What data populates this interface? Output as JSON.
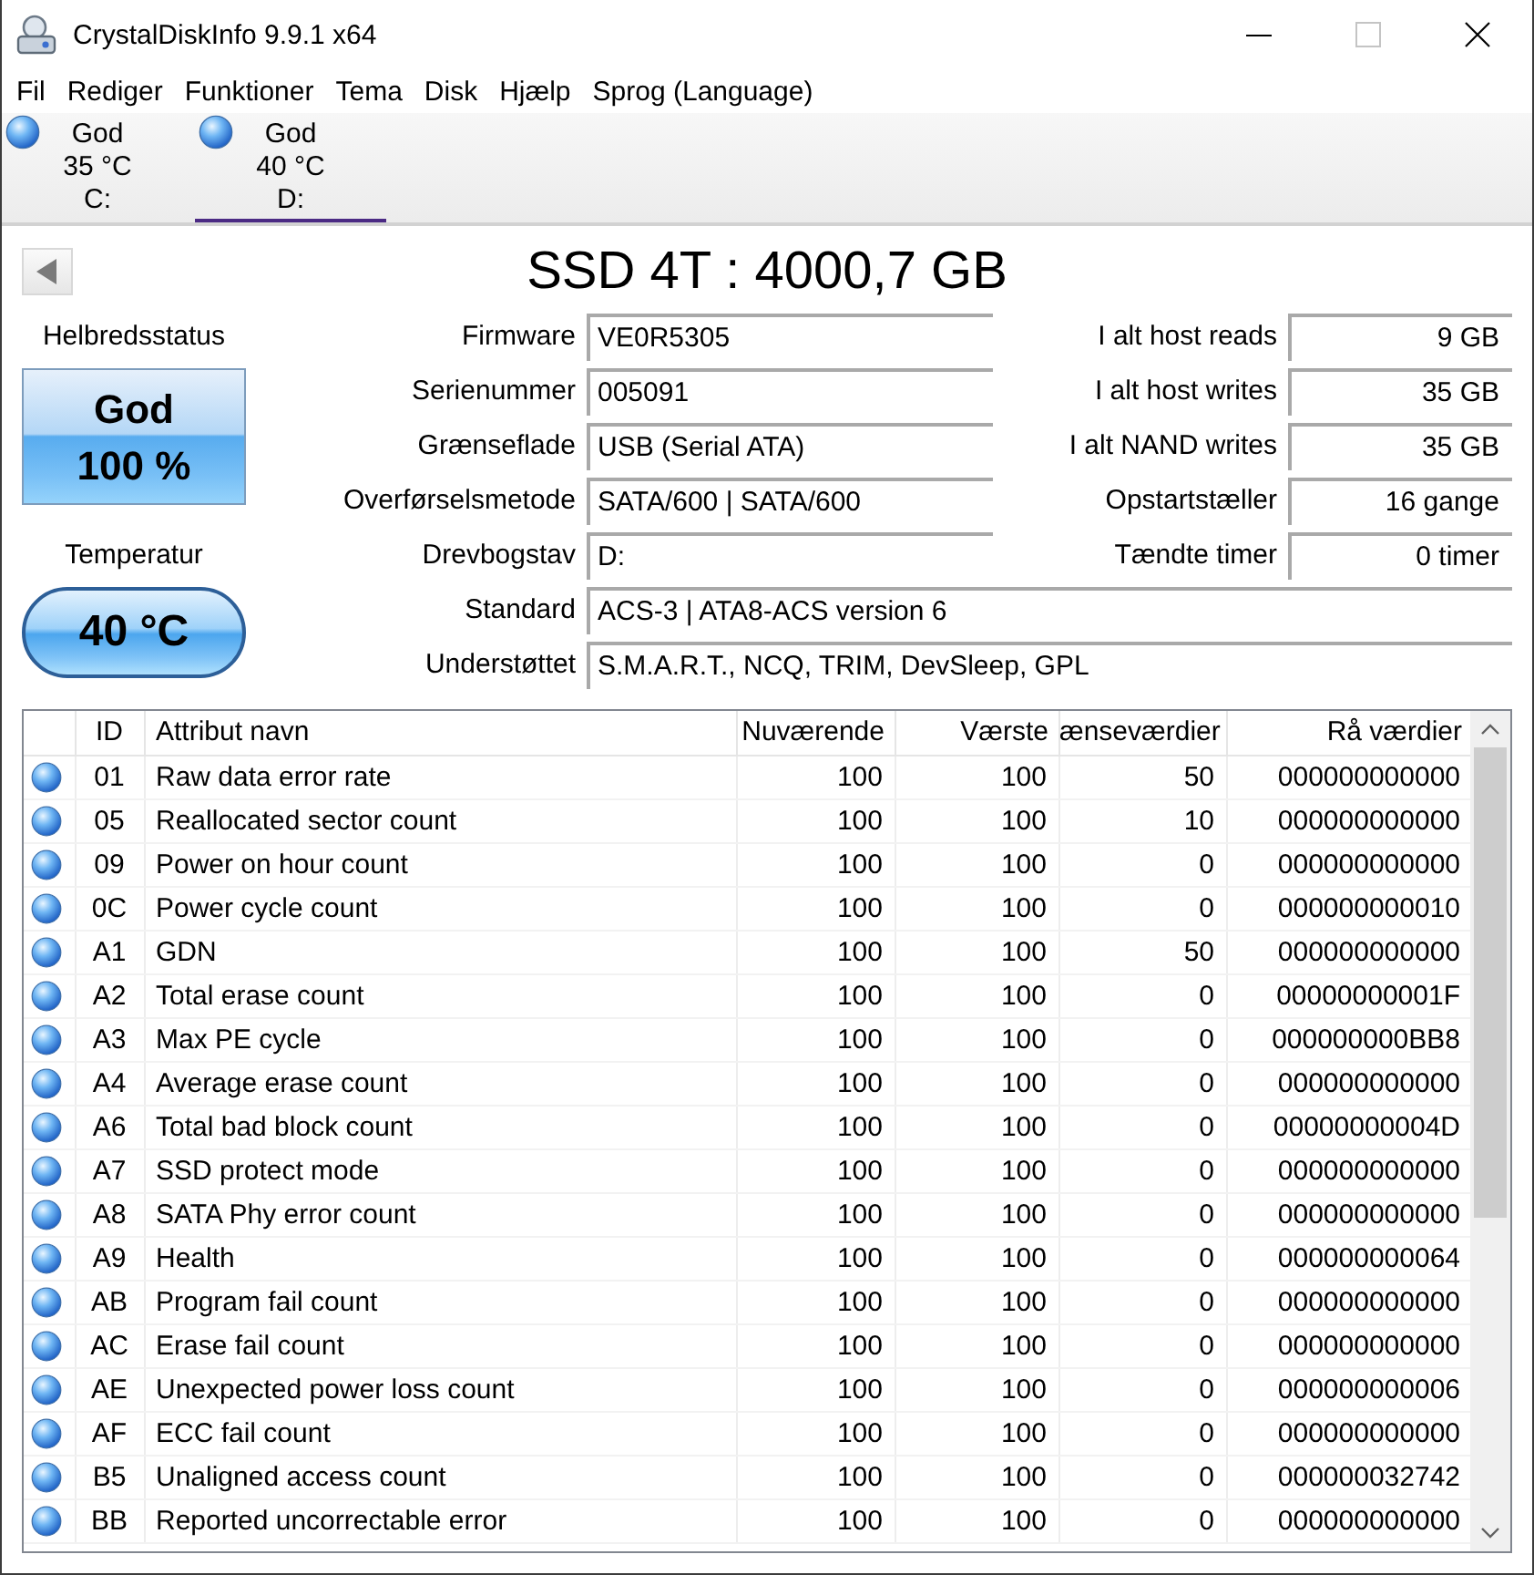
{
  "window": {
    "title": "CrystalDiskInfo 9.9.1 x64",
    "maximize_disabled": true
  },
  "menu": [
    "Fil",
    "Rediger",
    "Funktioner",
    "Tema",
    "Disk",
    "Hjælp",
    "Sprog (Language)"
  ],
  "disks": [
    {
      "status": "God",
      "temperature": "35 °C",
      "letter": "C:",
      "selected": false
    },
    {
      "status": "God",
      "temperature": "40 °C",
      "letter": "D:",
      "selected": true
    }
  ],
  "drive": {
    "title": "SSD 4T : 4000,7 GB",
    "health_label": "Helbredsstatus",
    "health_status": "God",
    "health_percent": "100 %",
    "temperature_label": "Temperatur",
    "temperature": "40 °C"
  },
  "info_rows": [
    {
      "label": "Firmware",
      "value": "VE0R5305",
      "side_label": "I alt host reads",
      "side_value": "9 GB"
    },
    {
      "label": "Serienummer",
      "value": "005091",
      "side_label": "I alt host writes",
      "side_value": "35 GB"
    },
    {
      "label": "Grænseflade",
      "value": "USB (Serial ATA)",
      "side_label": "I alt NAND writes",
      "side_value": "35 GB"
    },
    {
      "label": "Overførselsmetode",
      "value": "SATA/600 | SATA/600",
      "side_label": "Opstartstæller",
      "side_value": "16 gange"
    },
    {
      "label": "Drevbogstav",
      "value": "D:",
      "side_label": "Tændte timer",
      "side_value": "0 timer"
    },
    {
      "label": "Standard",
      "value": "ACS-3 | ATA8-ACS version 6"
    },
    {
      "label": "Understøttet",
      "value": "S.M.A.R.T., NCQ, TRIM, DevSleep, GPL"
    }
  ],
  "table": {
    "columns": [
      "ID",
      "Attribut navn",
      "Nuværende",
      "Værste",
      "ænseværdier",
      "Rå værdier"
    ],
    "rows": [
      {
        "id": "01",
        "name": "Raw data error rate",
        "current": "100",
        "worst": "100",
        "threshold": "50",
        "raw": "000000000000"
      },
      {
        "id": "05",
        "name": "Reallocated sector count",
        "current": "100",
        "worst": "100",
        "threshold": "10",
        "raw": "000000000000"
      },
      {
        "id": "09",
        "name": "Power on hour count",
        "current": "100",
        "worst": "100",
        "threshold": "0",
        "raw": "000000000000"
      },
      {
        "id": "0C",
        "name": "Power cycle count",
        "current": "100",
        "worst": "100",
        "threshold": "0",
        "raw": "000000000010"
      },
      {
        "id": "A1",
        "name": "GDN",
        "current": "100",
        "worst": "100",
        "threshold": "50",
        "raw": "000000000000"
      },
      {
        "id": "A2",
        "name": "Total erase count",
        "current": "100",
        "worst": "100",
        "threshold": "0",
        "raw": "00000000001F"
      },
      {
        "id": "A3",
        "name": "Max PE cycle",
        "current": "100",
        "worst": "100",
        "threshold": "0",
        "raw": "000000000BB8"
      },
      {
        "id": "A4",
        "name": "Average erase count",
        "current": "100",
        "worst": "100",
        "threshold": "0",
        "raw": "000000000000"
      },
      {
        "id": "A6",
        "name": "Total bad block count",
        "current": "100",
        "worst": "100",
        "threshold": "0",
        "raw": "00000000004D"
      },
      {
        "id": "A7",
        "name": "SSD protect mode",
        "current": "100",
        "worst": "100",
        "threshold": "0",
        "raw": "000000000000"
      },
      {
        "id": "A8",
        "name": "SATA Phy error count",
        "current": "100",
        "worst": "100",
        "threshold": "0",
        "raw": "000000000000"
      },
      {
        "id": "A9",
        "name": "Health",
        "current": "100",
        "worst": "100",
        "threshold": "0",
        "raw": "000000000064"
      },
      {
        "id": "AB",
        "name": "Program fail count",
        "current": "100",
        "worst": "100",
        "threshold": "0",
        "raw": "000000000000"
      },
      {
        "id": "AC",
        "name": "Erase fail count",
        "current": "100",
        "worst": "100",
        "threshold": "0",
        "raw": "000000000000"
      },
      {
        "id": "AE",
        "name": "Unexpected power loss count",
        "current": "100",
        "worst": "100",
        "threshold": "0",
        "raw": "000000000006"
      },
      {
        "id": "AF",
        "name": "ECC fail count",
        "current": "100",
        "worst": "100",
        "threshold": "0",
        "raw": "000000000000"
      },
      {
        "id": "B5",
        "name": "Unaligned access count",
        "current": "100",
        "worst": "100",
        "threshold": "0",
        "raw": "000000032742"
      },
      {
        "id": "BB",
        "name": "Reported uncorrectable error",
        "current": "100",
        "worst": "100",
        "threshold": "0",
        "raw": "000000000000"
      }
    ]
  }
}
